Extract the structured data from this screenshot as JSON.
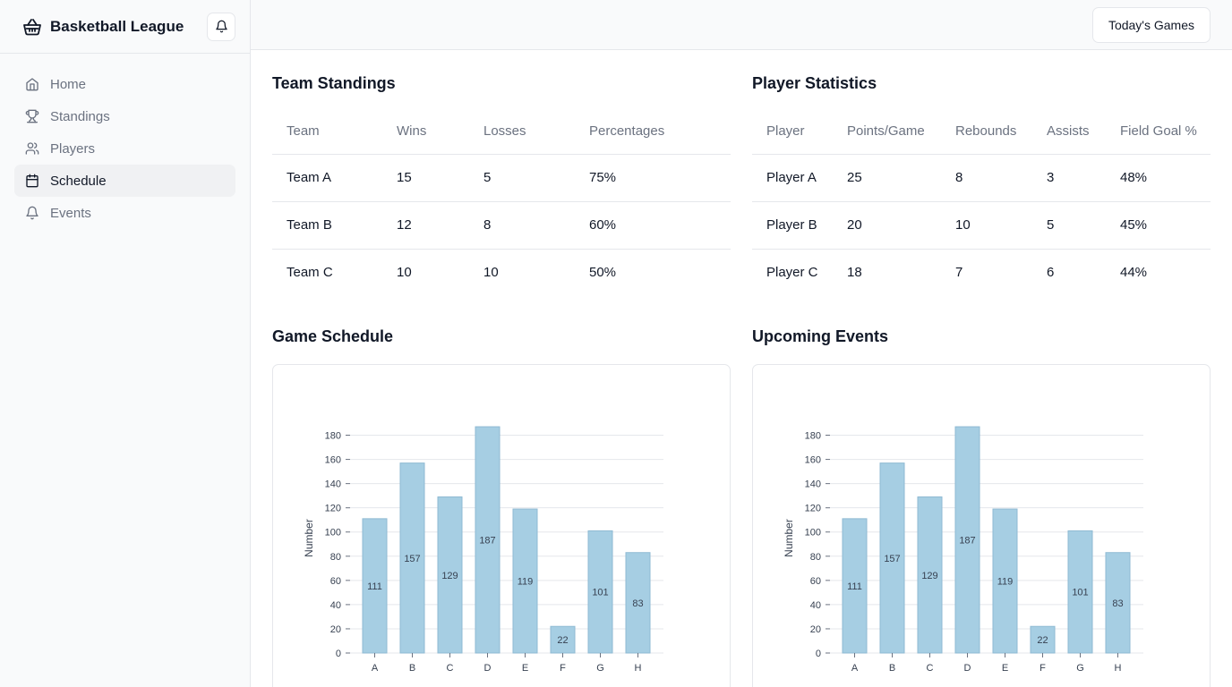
{
  "app": {
    "title": "Basketball League"
  },
  "sidebar": {
    "items": [
      {
        "label": "Home",
        "icon": "home-icon",
        "active": false
      },
      {
        "label": "Standings",
        "icon": "trophy-icon",
        "active": false
      },
      {
        "label": "Players",
        "icon": "users-icon",
        "active": false
      },
      {
        "label": "Schedule",
        "icon": "calendar-icon",
        "active": true
      },
      {
        "label": "Events",
        "icon": "bell-icon",
        "active": false
      }
    ]
  },
  "header": {
    "today_button": "Today's Games"
  },
  "standings": {
    "title": "Team Standings",
    "columns": [
      "Team",
      "Wins",
      "Losses",
      "Percentages"
    ],
    "rows": [
      [
        "Team A",
        "15",
        "5",
        "75%"
      ],
      [
        "Team B",
        "12",
        "8",
        "60%"
      ],
      [
        "Team C",
        "10",
        "10",
        "50%"
      ]
    ]
  },
  "players": {
    "title": "Player Statistics",
    "columns": [
      "Player",
      "Points/Game",
      "Rebounds",
      "Assists",
      "Field Goal %"
    ],
    "rows": [
      [
        "Player A",
        "25",
        "8",
        "3",
        "48%"
      ],
      [
        "Player B",
        "20",
        "10",
        "5",
        "45%"
      ],
      [
        "Player C",
        "18",
        "7",
        "6",
        "44%"
      ]
    ]
  },
  "schedule": {
    "title": "Game Schedule"
  },
  "events": {
    "title": "Upcoming Events"
  },
  "colors": {
    "bar_fill": "#a6cee3",
    "bar_stroke": "#8fbad3",
    "grid": "#e5e7eb"
  },
  "chart_data": [
    {
      "type": "bar",
      "categories": [
        "A",
        "B",
        "C",
        "D",
        "E",
        "F",
        "G",
        "H"
      ],
      "values": [
        111,
        157,
        129,
        187,
        119,
        22,
        101,
        83
      ],
      "ylabel": "Number",
      "xlabel": "",
      "yticks": [
        0,
        20,
        40,
        60,
        80,
        100,
        120,
        140,
        160,
        180
      ],
      "ylim": [
        0,
        190
      ],
      "grid": true
    },
    {
      "type": "bar",
      "categories": [
        "A",
        "B",
        "C",
        "D",
        "E",
        "F",
        "G",
        "H"
      ],
      "values": [
        111,
        157,
        129,
        187,
        119,
        22,
        101,
        83
      ],
      "ylabel": "Number",
      "xlabel": "",
      "yticks": [
        0,
        20,
        40,
        60,
        80,
        100,
        120,
        140,
        160,
        180
      ],
      "ylim": [
        0,
        190
      ],
      "grid": true
    }
  ]
}
